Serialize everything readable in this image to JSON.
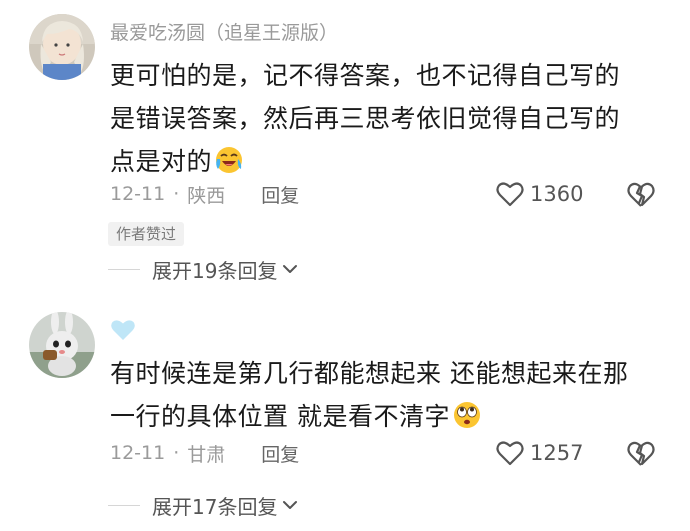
{
  "comments": [
    {
      "username": "最爱吃汤圆（追星王源版）",
      "lines": [
        "更可怕的是，记不得答案，也不记得自己写的",
        "是错误答案，然后再三思考依旧觉得自己写的",
        "点是对的"
      ],
      "emoji": "laughing-crying-emoji",
      "date": "12-11",
      "separator": "·",
      "location": "陕西",
      "reply_label": "回复",
      "likes": "1360",
      "author_tag": "作者赞过",
      "expand_label": "展开19条回复"
    },
    {
      "username": "",
      "badge": "light-blue-heart",
      "lines": [
        "有时候连是第几行都能想起来 还能想起来在那",
        "一行的具体位置 就是看不清字"
      ],
      "emoji": "rolling-eyes-emoji",
      "date": "12-11",
      "separator": "·",
      "location": "甘肃",
      "reply_label": "回复",
      "likes": "1257",
      "expand_label": "展开17条回复"
    }
  ],
  "colors": {
    "meta_gray": "#9a9a9a",
    "text": "#1a1a1a",
    "badge_blue": "#bfe6f7"
  }
}
